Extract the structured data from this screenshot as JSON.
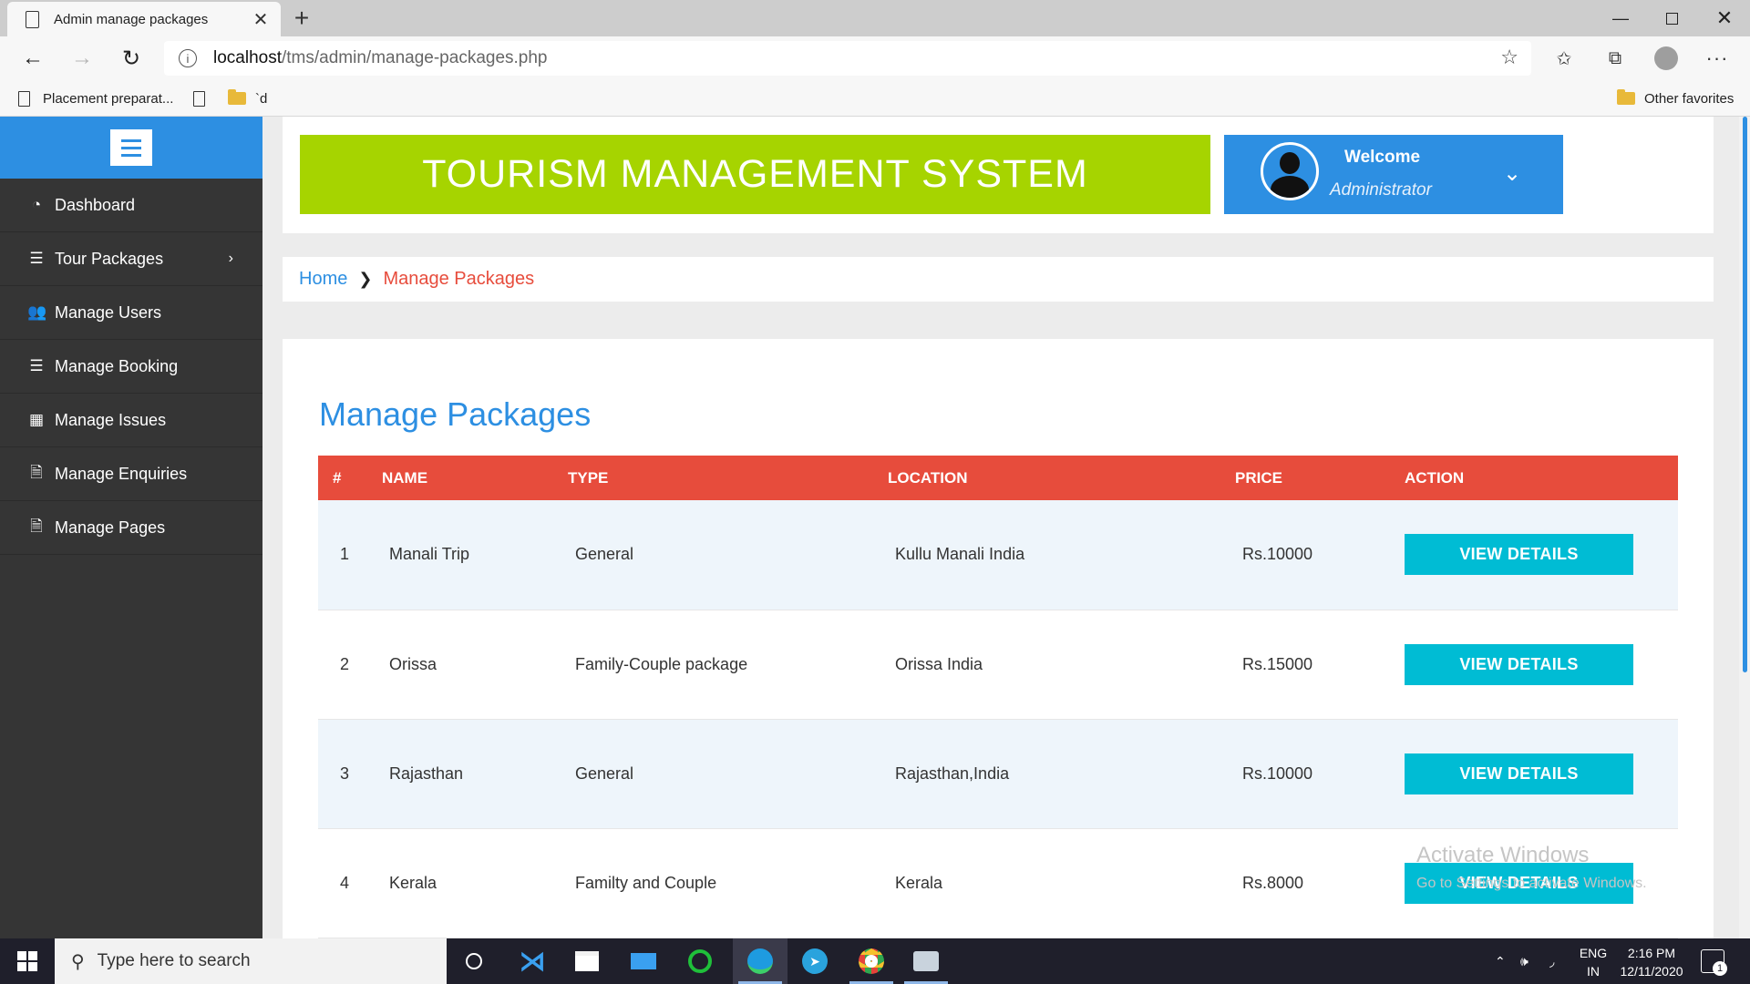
{
  "browser": {
    "tab_title": "Admin manage packages",
    "address_host": "localhost",
    "address_path": "/tms/admin/manage-packages.php",
    "favorites": [
      {
        "label": "Placement preparat..."
      },
      {
        "label": ""
      },
      {
        "label": "`d"
      }
    ],
    "other_favorites": "Other favorites"
  },
  "sidebar": {
    "items": [
      {
        "label": "Dashboard",
        "icon": "dashboard-icon"
      },
      {
        "label": "Tour Packages",
        "icon": "list-icon"
      },
      {
        "label": "Manage Users",
        "icon": "users-icon"
      },
      {
        "label": "Manage Booking",
        "icon": "list-icon"
      },
      {
        "label": "Manage Issues",
        "icon": "table-icon"
      },
      {
        "label": "Manage Enquiries",
        "icon": "file-icon"
      },
      {
        "label": "Manage Pages",
        "icon": "file-icon"
      }
    ]
  },
  "header": {
    "site_title": "TOURISM MANAGEMENT SYSTEM",
    "welcome": "Welcome",
    "role": "Administrator"
  },
  "breadcrumb": {
    "home": "Home",
    "current": "Manage Packages"
  },
  "main": {
    "title": "Manage Packages",
    "columns": [
      "#",
      "NAME",
      "TYPE",
      "LOCATION",
      "PRICE",
      "ACTION"
    ],
    "rows": [
      {
        "num": "1",
        "name": "Manali Trip",
        "type": "General",
        "location": "Kullu Manali India",
        "price": "Rs.10000",
        "action": "VIEW DETAILS"
      },
      {
        "num": "2",
        "name": "Orissa",
        "type": "Family-Couple package",
        "location": "Orissa India",
        "price": "Rs.15000",
        "action": "VIEW DETAILS"
      },
      {
        "num": "3",
        "name": "Rajasthan",
        "type": "General",
        "location": "Rajasthan,India",
        "price": "Rs.10000",
        "action": "VIEW DETAILS"
      },
      {
        "num": "4",
        "name": "Kerala",
        "type": "Familty and Couple",
        "location": "Kerala",
        "price": "Rs.8000",
        "action": "VIEW DETAILS"
      }
    ]
  },
  "watermark": {
    "title": "Activate Windows",
    "subtitle": "Go to Settings to activate Windows."
  },
  "taskbar": {
    "search_placeholder": "Type here to search",
    "lang_top": "ENG",
    "lang_bottom": "IN",
    "time": "2:16 PM",
    "date": "12/11/2020",
    "notification_count": "1"
  },
  "colors": {
    "accent_blue": "#2d8fe2",
    "banner_green": "#a6d400",
    "table_header_red": "#e74c3c",
    "button_cyan": "#00bcd4",
    "sidebar_dark": "#353535"
  }
}
